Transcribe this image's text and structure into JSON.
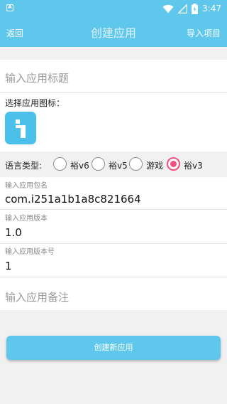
{
  "status_bar": {
    "time": "3:47",
    "app_badge": "A"
  },
  "app_bar": {
    "back_label": "返回",
    "title": "创建应用",
    "import_label": "导入项目"
  },
  "form": {
    "title_placeholder": "输入应用标题",
    "icon_label": "选择应用图标：",
    "language_label": "语言类型:",
    "language_options": [
      "裕v6",
      "裕v5",
      "游戏",
      "裕v3"
    ],
    "selected_language": "裕v3",
    "package_label": "输入应用包名",
    "package_value": "com.i251a1b1a8c821664",
    "version_label": "输入应用版本",
    "version_value": "1.0",
    "version_code_label": "输入应用版本号",
    "version_code_value": "1",
    "note_placeholder": "输入应用备注"
  },
  "actions": {
    "create_label": "创建新应用"
  },
  "colors": {
    "accent": "#5fc7ec",
    "radio_selected": "#ef4f80",
    "background": "#f1f1f1"
  }
}
